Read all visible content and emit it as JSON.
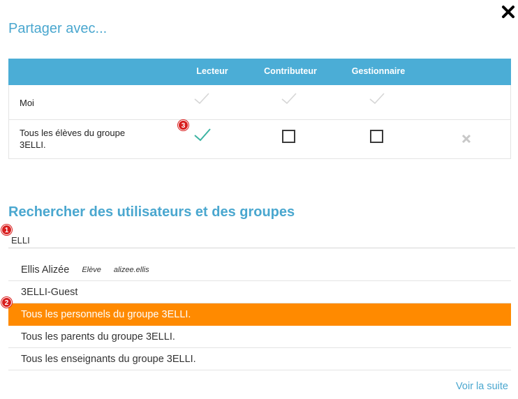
{
  "dialog": {
    "title": "Partager avec...",
    "close_icon": "close-x-icon"
  },
  "share_table": {
    "headers": [
      "",
      "Lecteur",
      "Contributeur",
      "Gestionnaire",
      ""
    ],
    "rows": [
      {
        "label": "Moi",
        "lecteur": "checked-disabled",
        "contributeur": "checked-disabled",
        "gestionnaire": "checked-disabled",
        "removable": false
      },
      {
        "label_line1": "Tous les élèves du groupe",
        "label_line2": "3ELLI.",
        "lecteur": "checked",
        "contributeur": "unchecked",
        "gestionnaire": "unchecked",
        "removable": true,
        "badge": "3"
      }
    ]
  },
  "search": {
    "title": "Rechercher des utilisateurs et des groupes",
    "value": "ELLI",
    "badge": "1"
  },
  "results": [
    {
      "name": "Ellis Alizée",
      "role": "Elève",
      "login": "alizee.ellis"
    },
    {
      "name": "3ELLI-Guest"
    },
    {
      "name": "Tous les personnels du groupe 3ELLI.",
      "selected": true,
      "badge": "2"
    },
    {
      "name": "Tous les parents du groupe 3ELLI."
    },
    {
      "name": "Tous les enseignants du groupe 3ELLI."
    }
  ],
  "more_link": "Voir la suite",
  "colors": {
    "accent": "#4aa7cf",
    "header_bg": "#4badd6",
    "selected_bg": "#ff8a00",
    "check_active": "#3bb3a2",
    "check_disabled": "#d6d6d6",
    "badge": "#d81e1e"
  }
}
